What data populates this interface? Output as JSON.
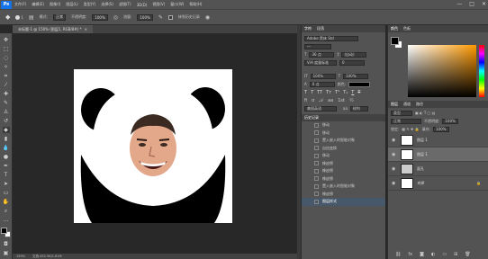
{
  "app": {
    "logo": "Ps"
  },
  "menu": [
    "文件(F)",
    "编辑(E)",
    "图像(I)",
    "图层(L)",
    "类型(Y)",
    "选择(S)",
    "滤镜(T)",
    "3D(D)",
    "视图(V)",
    "窗口(W)",
    "帮助(H)"
  ],
  "window_controls": [
    "—",
    "□",
    "✕"
  ],
  "options": {
    "brush_size": "1",
    "mode_label": "模式:",
    "mode_value": "正常",
    "opacity_label": "不透明度:",
    "opacity_value": "100%",
    "flow_label": "流量:",
    "flow_value": "100%",
    "history_label": "抹到历史记录"
  },
  "document": {
    "tab_title": "未标题-1 @ 150% (图层1, RGB/8#) *",
    "close": "×",
    "status_zoom": "150%",
    "status_doc": "文档:452.3K/1.81M"
  },
  "character_panel": {
    "tabs": [
      "字符",
      "段落"
    ],
    "font_family": "Adobe 黑体 Std",
    "font_style": "—",
    "size": "36 点",
    "leading": "(自动)",
    "kerning": "V/A 度量标准",
    "tracking": "0",
    "vertical_scale": "100%",
    "horizontal_scale": "100%",
    "baseline": "0 点",
    "color_label": "颜色:",
    "language": "美国英语",
    "antialias": "锐利"
  },
  "history_panel": {
    "title": "历史记录",
    "items": [
      "移动",
      "移动",
      "置入嵌入的智能对象",
      "自由变换",
      "移动",
      "橡皮擦",
      "橡皮擦",
      "橡皮擦",
      "置入嵌入的智能对象",
      "橡皮擦",
      "图层样式"
    ]
  },
  "color_panel": {
    "tabs": [
      "颜色",
      "色板"
    ]
  },
  "layers_panel": {
    "tabs": [
      "图层",
      "通道",
      "路径"
    ],
    "kind": "类型",
    "blend_mode": "正常",
    "opacity_label": "不透明度:",
    "opacity_value": "100%",
    "lock_label": "锁定:",
    "fill_label": "填充:",
    "fill_value": "100%",
    "layers": [
      {
        "name": "图层 1"
      },
      {
        "name": "图层 1"
      },
      {
        "name": "面孔"
      },
      {
        "name": "背景"
      }
    ]
  },
  "colors": {
    "accent": "#1473e6",
    "fg": "#000000",
    "bg": "#ffffff",
    "selected_row": "#46586a"
  }
}
